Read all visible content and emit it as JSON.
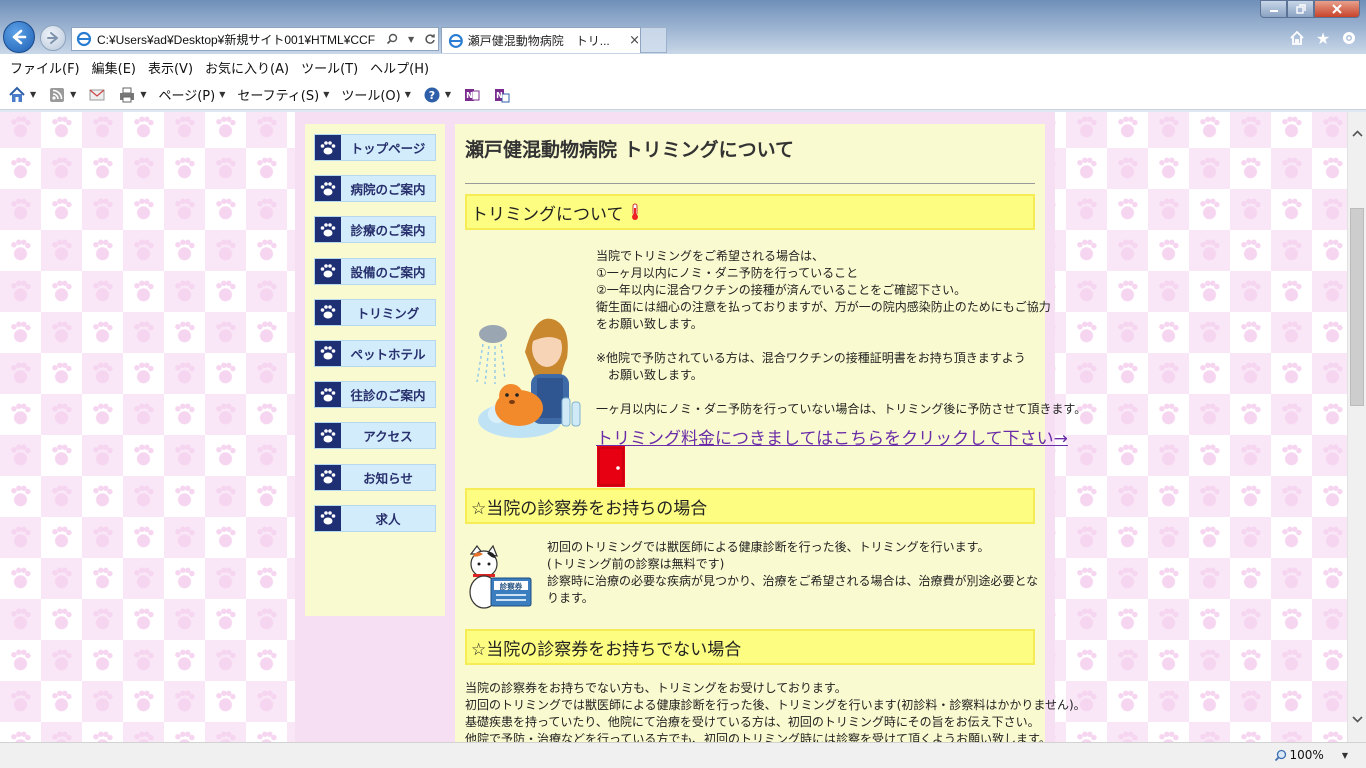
{
  "browser": {
    "address": "C:¥Users¥ad¥Desktop¥新規サイト001¥HTML¥CCF",
    "tab_title": "瀬戸健混動物病院　トリ...",
    "tab_close": "×",
    "zoom": "100%"
  },
  "menu": [
    "ファイル(F)",
    "編集(E)",
    "表示(V)",
    "お気に入り(A)",
    "ツール(T)",
    "ヘルプ(H)"
  ],
  "commands": {
    "page": "ページ(P)",
    "safety": "セーフティ(S)",
    "tools": "ツール(O)"
  },
  "sidenav": [
    "トップページ",
    "病院のご案内",
    "診療のご案内",
    "設備のご案内",
    "トリミング",
    "ペットホテル",
    "往診のご案内",
    "アクセス",
    "お知らせ",
    "求人"
  ],
  "main": {
    "title": "瀬戸健混動物病院  トリミングについて",
    "section1": {
      "heading": "トリミングについて",
      "lines": [
        "当院でトリミングをご希望される場合は、",
        "①一ヶ月以内にノミ・ダニ予防を行っていること",
        "②一年以内に混合ワクチンの接種が済んでいることをご確認下さい。",
        "衛生面には細心の注意を払っておりますが、万が一の院内感染防止のためにもご協力",
        "をお願い致します。",
        "",
        "※他院で予防されている方は、混合ワクチンの接種証明書をお持ち頂きますよう",
        "　お願い致します。",
        "",
        "一ヶ月以内にノミ・ダニ予防を行っていない場合は、トリミング後に予防させて頂きます。"
      ],
      "link": "トリミング料金につきましてはこちらをクリックして下さい→"
    },
    "section2": {
      "heading": "☆当院の診察券をお持ちの場合",
      "lines": [
        "初回のトリミングでは獣医師による健康診断を行った後、トリミングを行います。",
        "(トリミング前の診察は無料です)",
        "診察時に治療の必要な疾病が見つかり、治療をご希望される場合は、治療費が別途必要とな",
        "ります。"
      ],
      "card_label": "診察券"
    },
    "section3": {
      "heading": "☆当院の診察券をお持ちでない場合",
      "lines": [
        "当院の診察券をお持ちでない方も、トリミングをお受けしております。",
        "初回のトリミングでは獣医師による健康診断を行った後、トリミングを行います(初診料・診察料はかかりません)。",
        "基礎疾患を持っていたり、他院にて治療を受けている方は、初回のトリミング時にその旨をお伝え下さい。",
        "他院で予防・治療などを行っている方でも、初回のトリミング時には診察を受けて頂くようお願い致します。"
      ]
    }
  },
  "colors": {
    "section_fill": "#fdfd81",
    "section_border": "#f6ec55",
    "content_bg": "#fafad0",
    "page_frame": "#f7dff3",
    "nav_bg": "#d3ecfb",
    "nav_text": "#27306d",
    "link": "#6a2ca8"
  }
}
